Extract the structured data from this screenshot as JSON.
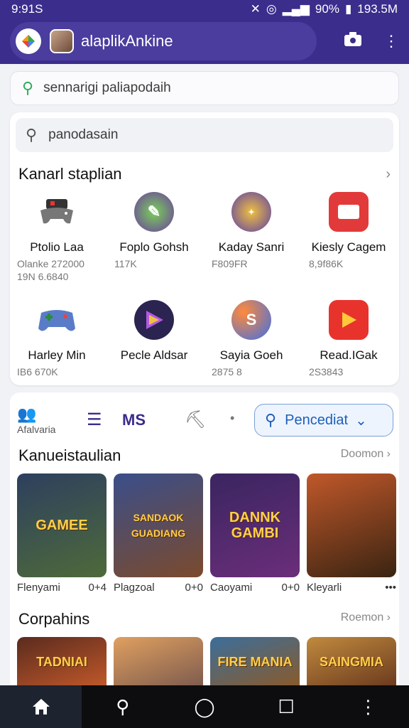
{
  "status_bar": {
    "time": "9:91S",
    "battery": "90%",
    "speed": "193.5M"
  },
  "app_bar": {
    "title": "alaplikAnkine"
  },
  "top_search": {
    "value": "sennarigi paliapodaih"
  },
  "featured_card": {
    "search_value": "panodasain",
    "section_title": "Kanarl staplian",
    "apps": [
      {
        "name": "Ptolio Laa",
        "meta": "Olanke 272000\n19N 6.6840",
        "icon": "gamepad-icon",
        "color": "#ffffff"
      },
      {
        "name": "Foplo Gohsh",
        "meta": "117K",
        "icon": "green-pencil-icon",
        "color": "#3aa35b"
      },
      {
        "name": "Kaday Sanri",
        "meta": "F809FR",
        "icon": "winged-emblem-icon",
        "color": "#5b3ea8"
      },
      {
        "name": "Kiesly Cagem",
        "meta": "8,9f86K",
        "icon": "red-square-icon",
        "color": "#e23a3a"
      },
      {
        "name": "Harley Min",
        "meta": "IB6 670K",
        "icon": "controller-icon",
        "color": "#4d7bd6"
      },
      {
        "name": "Pecle Aldsar",
        "meta": "",
        "icon": "play-triangle-icon",
        "color": "#2b2350"
      },
      {
        "name": "Sayia Goeh",
        "meta": "2875 8",
        "icon": "swirl-icon",
        "color": "#3d6fe8"
      },
      {
        "name": "Read.IGak",
        "meta": "2S3843",
        "icon": "red-play-icon",
        "color": "#e8332d"
      }
    ]
  },
  "tabs": {
    "people_label": "Afalvaria",
    "ms_label": "MS",
    "filter_label": "Pencediat"
  },
  "games_section": {
    "title": "Kanueistaulian",
    "more_label": "Doomon",
    "games": [
      {
        "label": "Flenyami",
        "meta": "0+4",
        "art": "GAMEE",
        "bg": "#2d3f5e"
      },
      {
        "label": "Plagzoal",
        "meta": "0+0",
        "art": "SANDAOK\nGUADIANG",
        "bg": "#7b4a2d"
      },
      {
        "label": "Caoyami",
        "meta": "0+0",
        "art": "DANNK\nGAMBI",
        "bg": "#3a2560"
      },
      {
        "label": "Kleyarli",
        "meta": "•••",
        "art": "",
        "bg": "#8b3a1e"
      }
    ]
  },
  "second_section": {
    "title": "Corpahins",
    "more_label": "Roemon",
    "games": [
      {
        "art": "TADNIAI",
        "bg": "#5a2b1e"
      },
      {
        "art": "",
        "bg": "#7d5b4e"
      },
      {
        "art": "FIRE MANIA",
        "bg": "#3b6e9a"
      },
      {
        "art": "SAINGMIA",
        "bg": "#c08a3e"
      }
    ]
  }
}
